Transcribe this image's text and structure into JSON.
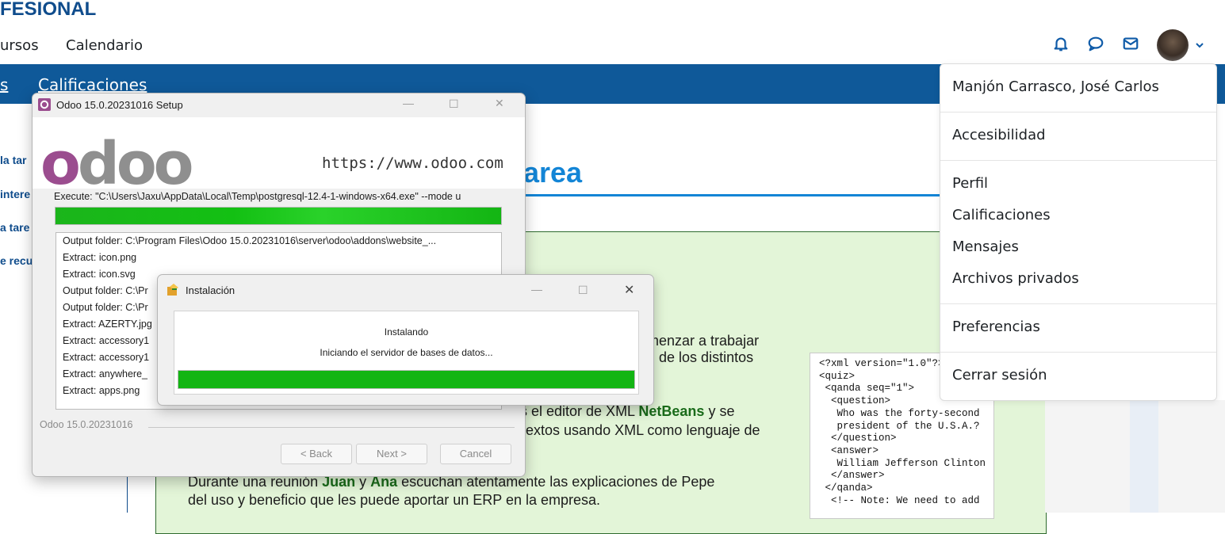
{
  "site": {
    "brand": "FESIONAL",
    "nav": [
      "ursos",
      "Calendario"
    ],
    "subnav": [
      "s",
      "Calificaciones"
    ],
    "icons": [
      "bell-icon",
      "chat-icon",
      "mail-icon"
    ]
  },
  "leftnav": [
    "la tar",
    "intere",
    "a tare",
    "e recu"
  ],
  "page": {
    "title": "area",
    "p1_lines": [
      "omenzar a trabajar",
      "ón de los distintos"
    ],
    "p2_line1_pre": "s el editor de XML ",
    "p2_line1_bold": "NetBeans",
    "p2_line1_post": " y se",
    "p2_line2": "extos usando XML como lenguaje de",
    "p3_pre": "Durante una reunión ",
    "p3_b1": "Juan",
    "p3_mid": " y ",
    "p3_b2": "Ana",
    "p3_post": " escuchan atentamente las explicaciones de Pepe",
    "p3_line2": "del uso y beneficio que les puede aportar un ERP en la empresa.",
    "xml": "<?xml version=\"1.0\"?>\n<quiz>\n <qanda seq=\"1\">\n  <question>\n   Who was the forty-second\n   president of the U.S.A.?\n  </question>\n  <answer>\n   William Jefferson Clinton\n  </answer>\n </qanda>\n  <!-- Note: We need to add"
  },
  "usermenu": {
    "name": "Manjón Carrasco, José Carlos",
    "items": [
      "Accesibilidad",
      "Perfil",
      "Calificaciones",
      "Mensajes",
      "Archivos privados",
      "Preferencias",
      "Cerrar sesión"
    ]
  },
  "setup": {
    "title": "Odoo 15.0.20231016 Setup",
    "url": "https://www.odoo.com",
    "logo": "odoo",
    "execute": "Execute: \"C:\\Users\\Jaxu\\AppData\\Local\\Temp\\postgresql-12.4-1-windows-x64.exe\" --mode u",
    "progress": 1.0,
    "log": [
      "Output folder: C:\\Program Files\\Odoo 15.0.20231016\\server\\odoo\\addons\\website_...",
      "Extract: icon.png",
      "Extract: icon.svg",
      "Output folder: C:\\Pr",
      "Output folder: C:\\Pr",
      "Extract: AZERTY.jpg",
      "Extract: accessory1",
      "Extract: accessory1",
      "Extract: anywhere_",
      "Extract: apps.png"
    ],
    "footer": "Odoo 15.0.20231016",
    "buttons": {
      "back": "< Back",
      "next": "Next >",
      "cancel": "Cancel"
    }
  },
  "install": {
    "title": "Instalación",
    "status": "Instalando",
    "detail": "Iniciando el servidor de bases de datos...",
    "progress": 1.0
  }
}
